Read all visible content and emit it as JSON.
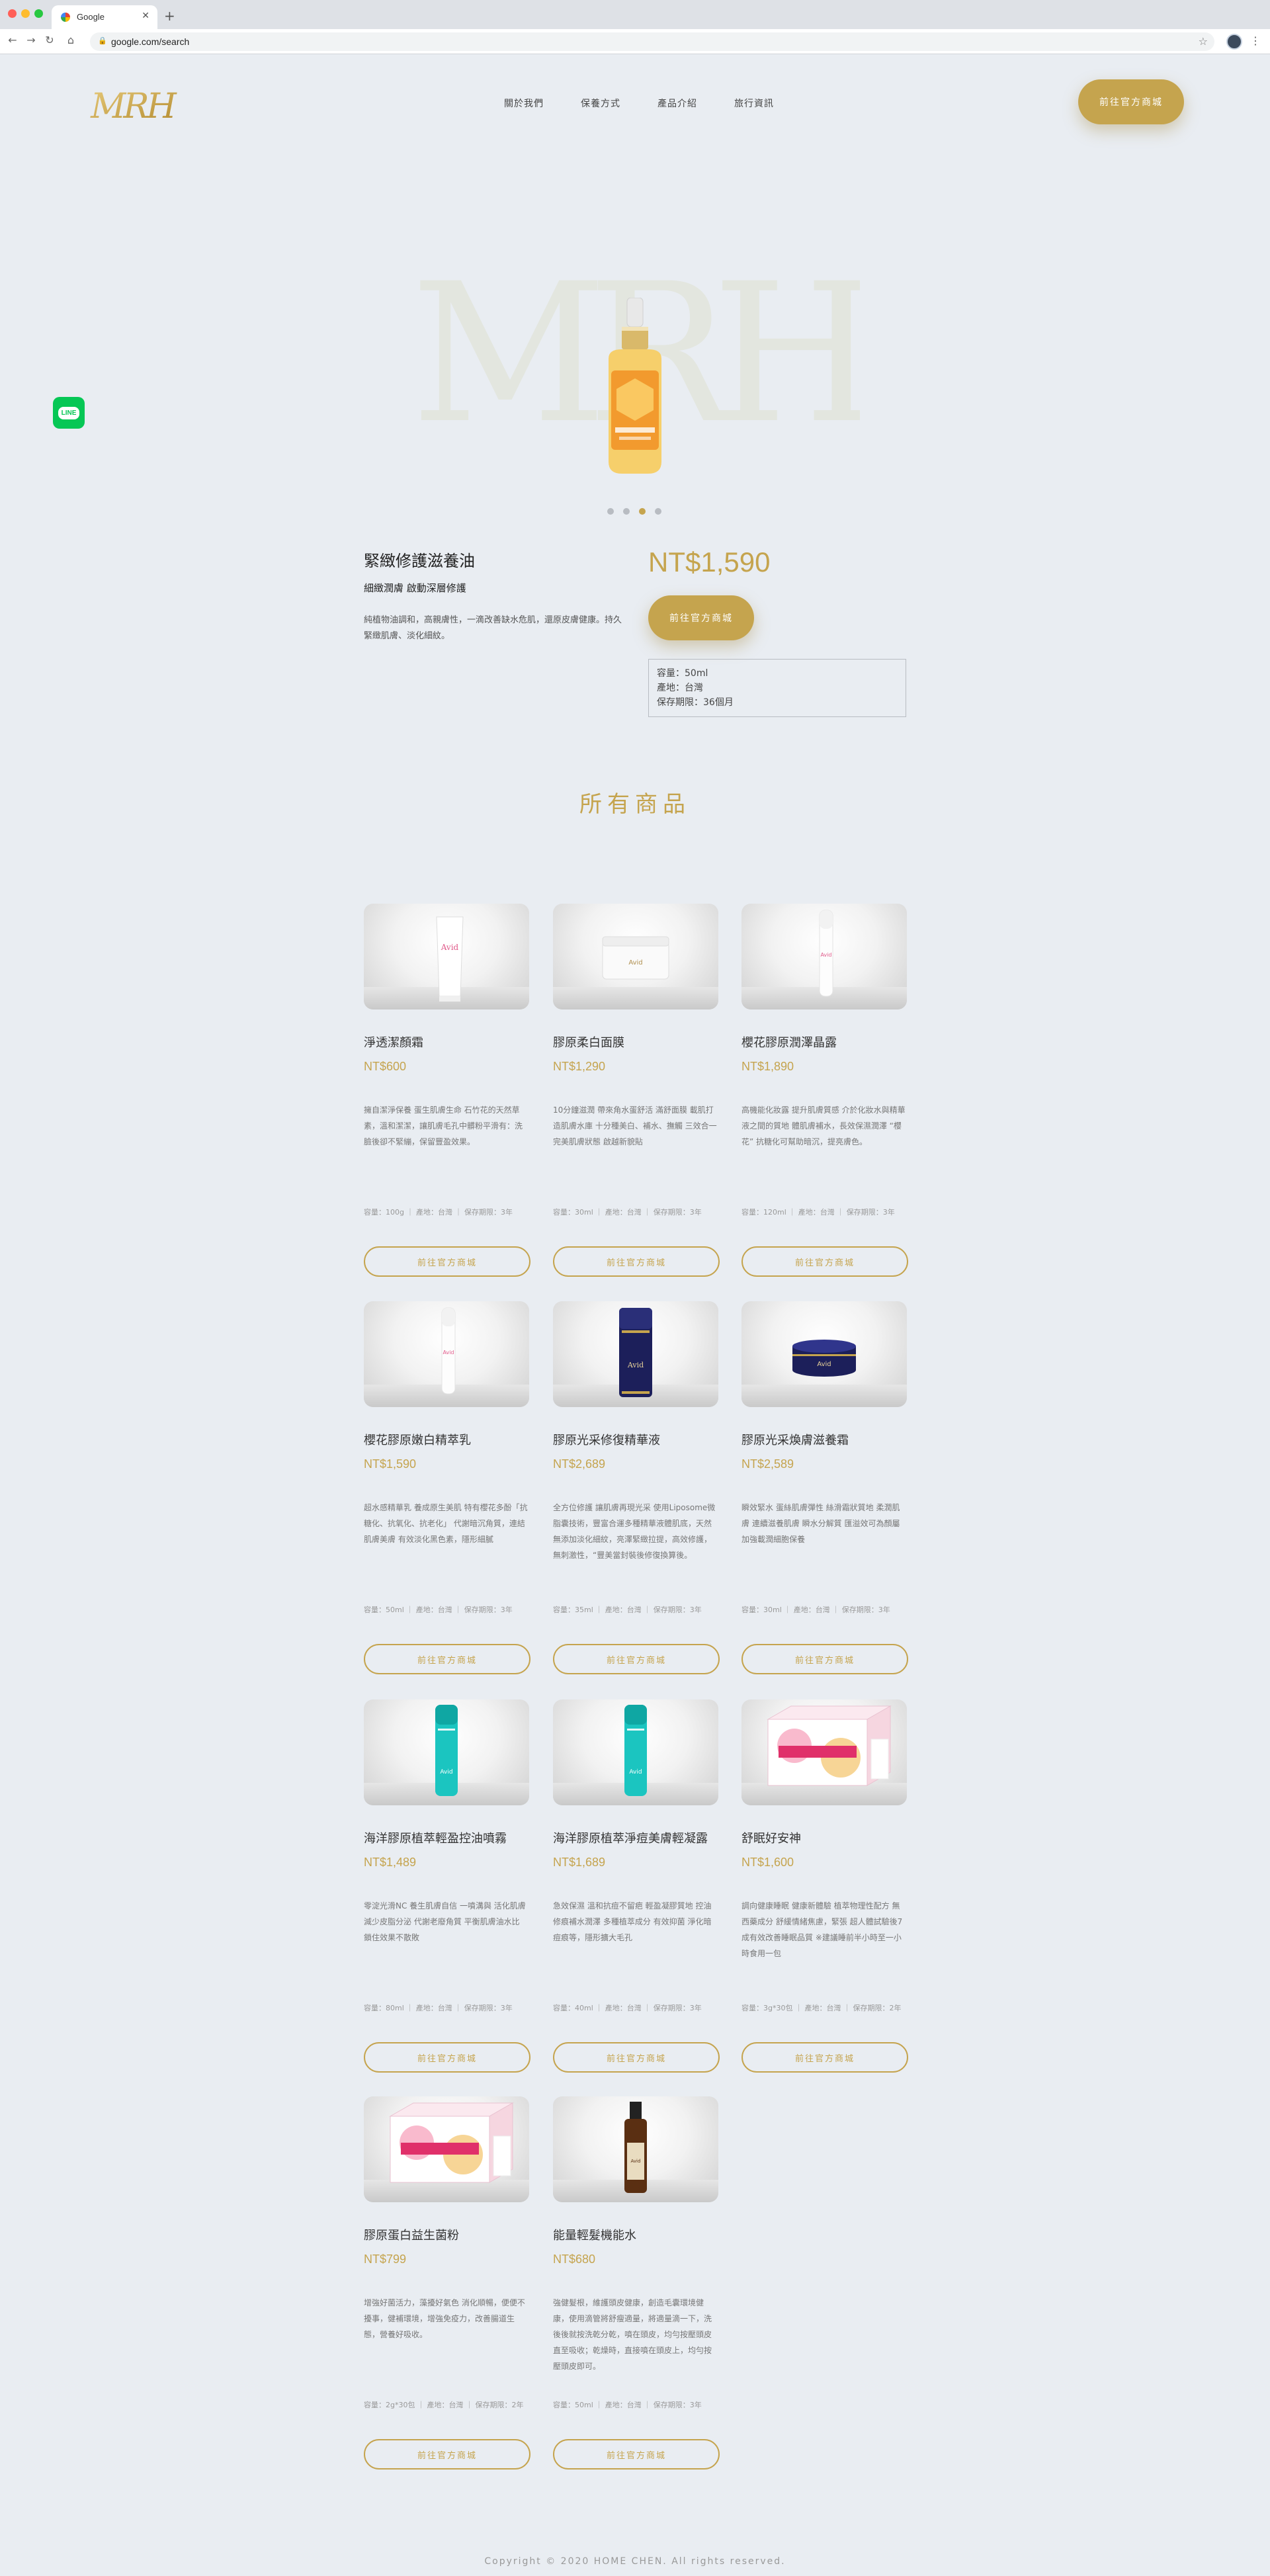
{
  "browser": {
    "tab_title": "Google",
    "url": "google.com/search"
  },
  "header": {
    "logo_text": "MRH",
    "nav": [
      "關於我們",
      "保養方式",
      "產品介紹",
      "旅行資訊"
    ],
    "cta_label": "前往官方商城"
  },
  "line_widget": {
    "label": "LINE"
  },
  "hero": {
    "watermark": "MRH",
    "slides": 4,
    "active_slide": 3
  },
  "featured": {
    "name": "緊緻修護滋養油",
    "subtitle": "細緻潤膚 啟動深層修護",
    "description": "純植物油調和，高親膚性，一滴改善缺水危肌，還原皮膚健康。持久緊緻肌膚、淡化細紋。",
    "price": "NT$1,590",
    "cta_label": "前往官方商城",
    "specs": [
      "容量：50ml",
      "產地：台灣",
      "保存期限：36個月"
    ]
  },
  "all_products_title": "所有商品",
  "products": [
    {
      "name": "淨透潔顏霜",
      "price": "NT$600",
      "desc": "擁自潔淨保養 蛋生肌膚生命 石竹花的天然草素，溫和潔潔，讓肌膚毛孔中髒粉平滑有：洗臉後卻不緊繃，保留豐盈效果。",
      "spec": "容量：100g ｜ 產地：台灣 ｜ 保存期限：3年",
      "btn": "前往官方商城",
      "visual": "tube"
    },
    {
      "name": "膠原柔白面膜",
      "price": "NT$1,290",
      "desc": "10分鐘滋潤 帶來角水蛋舒活 滿舒面膜 載肌打造肌膚水庫 十分種美白、補水、撫觸 三效合一完美肌膚狀態 啟越新貌貼",
      "spec": "容量：30ml ｜ 產地：台灣 ｜ 保存期限：3年",
      "btn": "前往官方商城",
      "visual": "jar-white"
    },
    {
      "name": "櫻花膠原潤澤晶露",
      "price": "NT$1,890",
      "desc": "高機能化妝露 提升肌膚質感 介於化妝水與精華液之間的質地 體肌膚補水，長效保濕潤澤 “櫻花” 抗糖化可幫助暗沉，提亮膚色。",
      "spec": "容量：120ml ｜ 產地：台灣 ｜ 保存期限：3年",
      "btn": "前往官方商城",
      "visual": "slim-white"
    },
    {
      "name": "櫻花膠原嫩白精萃乳",
      "price": "NT$1,590",
      "desc": "超水感精華乳 養成原生美肌 特有櫻花多酚「抗糖化、抗氧化、抗老化」 代謝暗沉角質，連結肌膚美膚 有效淡化黑色素，隱形細膩",
      "spec": "容量：50ml ｜ 產地：台灣 ｜ 保存期限：3年",
      "btn": "前往官方商城",
      "visual": "slim-white"
    },
    {
      "name": "膠原光采修復精華液",
      "price": "NT$2,689",
      "desc": "全方位修護 讓肌膚再現光采 使用Liposome微脂囊技術，豐富合運多種精華液體肌底，天然無添加淡化細紋，亮澤緊緻拉提，高效修護，無刺激性，“豐美當封裝後修復換算後。",
      "spec": "容量：35ml ｜ 產地：台灣 ｜ 保存期限：3年",
      "btn": "前往官方商城",
      "visual": "navy-bottle"
    },
    {
      "name": "膠原光采煥膚滋養霜",
      "price": "NT$2,589",
      "desc": "瞬效緊水 蛋絲肌膚彈性 絲滑霜狀質地 柔潤肌膚 連續滋養肌膚 瞬水分解質 匯溢效可為顏屬 加強載潤細胞保養",
      "spec": "容量：30ml ｜ 產地：台灣 ｜ 保存期限：3年",
      "btn": "前往官方商城",
      "visual": "navy-jar"
    },
    {
      "name": "海洋膠原植萃輕盈控油噴霧",
      "price": "NT$1,489",
      "desc": "零淀光滑NC 養生肌膚自信 一噴溝與 活化肌膚 減少皮脂分泌 代謝老廢角質 平衡肌膚油水比 鎖住效果不散敗",
      "spec": "容量：80ml ｜ 產地：台灣 ｜ 保存期限：3年",
      "btn": "前往官方商城",
      "visual": "teal-bottle"
    },
    {
      "name": "海洋膠原植萃淨痘美膚輕凝露",
      "price": "NT$1,689",
      "desc": "急效保濕 溫和抗痘不留疤 輕盈凝膠質地 控油修痕補水潤澤 多種植萃成分 有效抑菌 淨化暗痘痕等，隱形擴大毛孔",
      "spec": "容量：40ml ｜ 產地：台灣 ｜ 保存期限：3年",
      "btn": "前往官方商城",
      "visual": "teal-bottle"
    },
    {
      "name": "舒眠好安神",
      "price": "NT$1,600",
      "desc": "調向健康睡眠 健康新體驗 植萃物理性配方 無西藥成分 舒緩情緒焦慮，緊張 超人體試驗後7成有效改善睡眠品質 ※建議睡前半小時至一小時食用一包",
      "spec": "容量：3g*30包 ｜ 產地：台灣 ｜ 保存期限：2年",
      "btn": "前往官方商城",
      "visual": "box"
    },
    {
      "name": "膠原蛋白益生菌粉",
      "price": "NT$799",
      "desc": "增強好菌活力，藻擾好氣色 消化順暢，便便不擾事，健補環境，增強免疫力，改善腸道生態，營養好吸收。",
      "spec": "容量：2g*30包 ｜ 產地：台灣 ｜ 保存期限：2年",
      "btn": "前往官方商城",
      "visual": "box"
    },
    {
      "name": "能量輕髮機能水",
      "price": "NT$680",
      "desc": "強健髮根，維護頭皮健康，創造毛囊環境健康，使用滴管將舒瘦適量，將適量滴一下，洗後後就按洗乾分乾，噴在頭皮，均勻按壓頭皮直至吸收；乾燥時，直接噴在頭皮上，均勻按壓頭皮即可。",
      "spec": "容量：50ml ｜ 產地：台灣 ｜ 保存期限：3年",
      "btn": "前往官方商城",
      "visual": "amber-bottle"
    }
  ],
  "footer": "Copyright © 2020 HOME CHEN. All rights reserved.",
  "colors": {
    "gold": "#c5a44e",
    "page_bg": "#e9edf2",
    "line_green": "#06c755"
  }
}
